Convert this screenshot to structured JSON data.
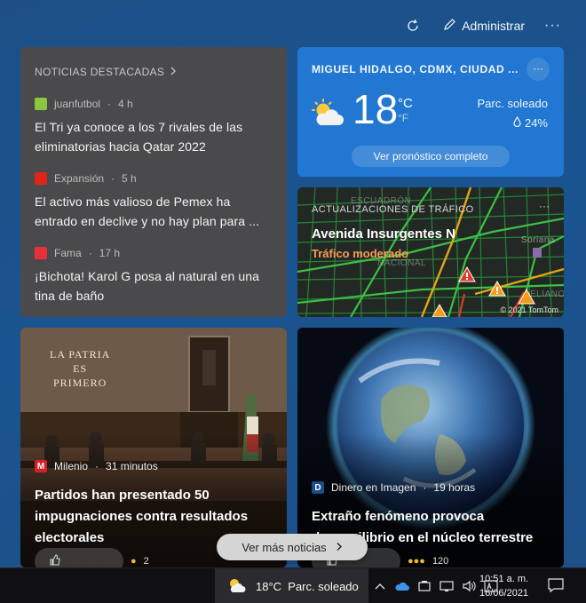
{
  "header": {
    "manage_label": "Administrar",
    "more": "···"
  },
  "top_news": {
    "header": "NOTICIAS DESTACADAS",
    "items": [
      {
        "source": "juanfutbol",
        "age": "4 h",
        "headline": "El Tri ya conoce a los 7 rivales de las eliminatorias hacia Qatar 2022",
        "logo_color": "#8cc63f"
      },
      {
        "source": "Expansión",
        "age": "5 h",
        "headline": "El activo más valioso de Pemex ha entrado en declive y no hay plan para ...",
        "logo_color": "#e2231a"
      },
      {
        "source": "Fama",
        "age": "17 h",
        "headline": "¡Bichota! Karol G posa al natural en una tina de baño",
        "logo_color": "#e8303a"
      }
    ]
  },
  "weather": {
    "location": "MIGUEL HIDALGO, CDMX, CIUDAD ...",
    "temperature": "18",
    "unit_c": "°C",
    "unit_f": "°F",
    "condition": "Parc. soleado",
    "precipitation": "24%",
    "forecast_button": "Ver pronóstico completo",
    "icon": "partly-sunny-icon"
  },
  "traffic": {
    "header": "ACTUALIZACIONES DE TRÁFICO",
    "road": "Avenida Insurgentes N",
    "status": "Tráfico moderado",
    "copyright": "© 2021 TomTom",
    "map_labels": [
      "ESCUADRÓN",
      "NACIONAL",
      "ELIANO",
      "Soriana"
    ]
  },
  "stories": [
    {
      "source": "Milenio",
      "age": "31 minutos",
      "headline": "Partidos han presentado 50 impugnaciones contra resultados electorales",
      "logo_color": "#d31f26",
      "sign_lines": [
        "LA PATRIA",
        "ES",
        "PRIMERO"
      ],
      "reaction_count": "2"
    },
    {
      "source": "Dinero en Imagen",
      "age": "19 horas",
      "headline": "Extraño fenómeno provoca desequilibrio en el núcleo terrestre",
      "logo_color": "#1b4c8a",
      "reaction_count": "120"
    }
  ],
  "more_news": {
    "label": "Ver más noticias"
  },
  "taskbar": {
    "weather_text": "18°C  Parc. soleado",
    "time": "10:51 a. m.",
    "date": "16/06/2021"
  }
}
